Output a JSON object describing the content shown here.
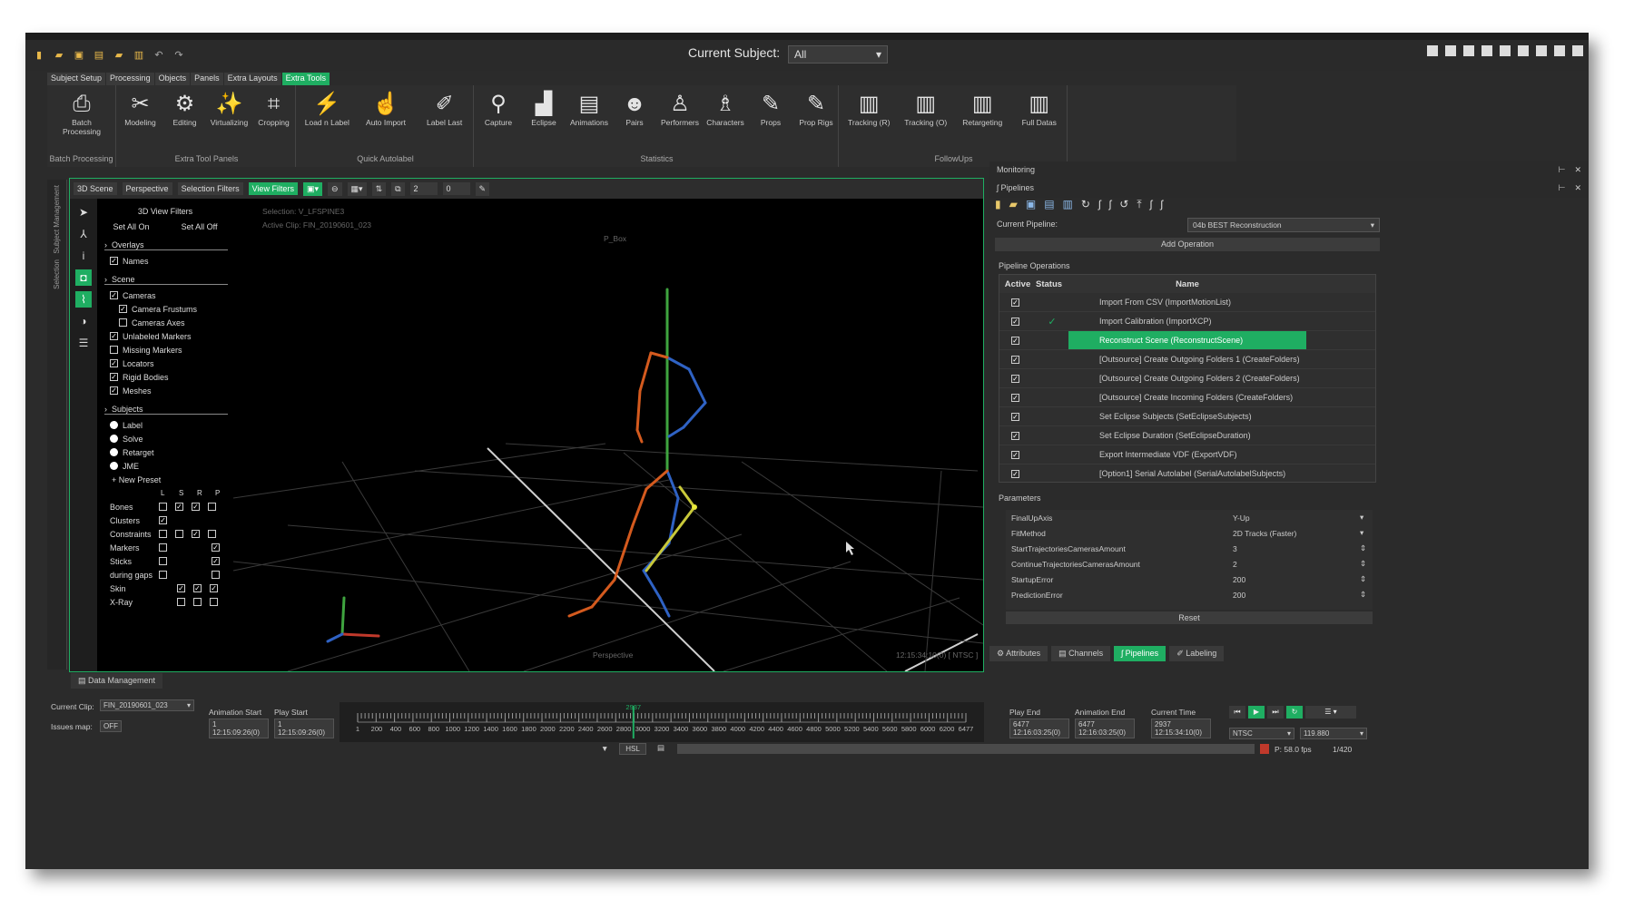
{
  "toolbar": {
    "current_subject_label": "Current Subject:",
    "current_subject_value": "All"
  },
  "tabs": [
    "Subject Setup",
    "Processing",
    "Objects",
    "Panels",
    "Extra Layouts",
    "Extra Tools"
  ],
  "active_tab": "Extra Tools",
  "ribbon": {
    "groups": [
      {
        "label": "Batch Processing",
        "buttons": [
          "Batch Processing"
        ]
      },
      {
        "label": "Extra Tool Panels",
        "buttons": [
          "Modeling",
          "Editing",
          "Virtualizing",
          "Cropping"
        ]
      },
      {
        "label": "Quick Autolabel",
        "buttons": [
          "Load n Label",
          "Auto Import",
          "Label Last"
        ]
      },
      {
        "label": "Statistics",
        "buttons": [
          "Capture",
          "Eclipse",
          "Animations",
          "Pairs",
          "Performers",
          "Characters",
          "Props",
          "Prop Rigs"
        ]
      },
      {
        "label": "FollowUps",
        "buttons": [
          "Tracking (R)",
          "Tracking (O)",
          "Retargeting",
          "Full Datas"
        ]
      }
    ]
  },
  "left_strip": {
    "tab1": "Subject Management",
    "tab2": "Selection"
  },
  "viewport": {
    "toolbar": [
      "3D Scene",
      "Perspective",
      "Selection Filters",
      "View Filters",
      "2",
      "0"
    ],
    "selection": "Selection: V_LFSPINE3",
    "active_clip": "Active Clip: FIN_20190601_023",
    "object_label": "P_Box",
    "camera_label": "Perspective",
    "timecode": "12:15:34:10(0) [ NTSC ]",
    "filters_title": "3D View Filters",
    "set_all_on": "Set All On",
    "set_all_off": "Set All Off",
    "overlays": "Overlays",
    "names": "Names",
    "scene": "Scene",
    "scene_items": [
      {
        "label": "Cameras",
        "checked": true,
        "indent": 0
      },
      {
        "label": "Camera Frustums",
        "checked": true,
        "indent": 1
      },
      {
        "label": "Cameras Axes",
        "checked": false,
        "indent": 1
      },
      {
        "label": "Unlabeled Markers",
        "checked": true,
        "indent": 0
      },
      {
        "label": "Missing Markers",
        "checked": false,
        "indent": 0
      },
      {
        "label": "Locators",
        "checked": true,
        "indent": 0
      },
      {
        "label": "Rigid Bodies",
        "checked": true,
        "indent": 0
      },
      {
        "label": "Meshes",
        "checked": true,
        "indent": 0
      }
    ],
    "subjects": "Subjects",
    "subject_presets": [
      "Label",
      "Solve",
      "Retarget",
      "JME"
    ],
    "new_preset": "+ New Preset",
    "grid_headers": [
      "L",
      "S",
      "R",
      "P"
    ],
    "grid_rows": [
      {
        "label": "Bones",
        "v": [
          0,
          1,
          1,
          0
        ]
      },
      {
        "label": "Clusters",
        "v": [
          1,
          -1,
          -1,
          -1
        ]
      },
      {
        "label": "Constraints",
        "v": [
          0,
          0,
          1,
          0
        ]
      },
      {
        "label": "Markers",
        "v": [
          0,
          -1,
          -1,
          1
        ]
      },
      {
        "label": "Sticks",
        "v": [
          0,
          -1,
          -1,
          1
        ]
      },
      {
        "label": "during gaps",
        "v": [
          0,
          -1,
          -1,
          0
        ]
      },
      {
        "label": "Skin",
        "v": [
          -1,
          1,
          1,
          1
        ]
      },
      {
        "label": "X-Ray",
        "v": [
          -1,
          0,
          0,
          0
        ]
      }
    ]
  },
  "monitoring": {
    "title": "Monitoring"
  },
  "pipelines": {
    "title": "Pipelines",
    "current_label": "Current Pipeline:",
    "current_value": "04b BEST Reconstruction",
    "add_operation": "Add Operation",
    "ops_label": "Pipeline Operations",
    "headers": {
      "active": "Active",
      "status": "Status",
      "name": "Name"
    },
    "operations": [
      {
        "name": "Import From CSV (ImportMotionList)",
        "status": ""
      },
      {
        "name": "Import Calibration (ImportXCP)",
        "status": "✓"
      },
      {
        "name": "Reconstruct Scene (ReconstructScene)",
        "status": ""
      },
      {
        "name": "[Outsource] Create Outgoing Folders 1 (CreateFolders)",
        "status": ""
      },
      {
        "name": "[Outsource] Create Outgoing Folders 2 (CreateFolders)",
        "status": ""
      },
      {
        "name": "[Outsource] Create Incoming Folders (CreateFolders)",
        "status": ""
      },
      {
        "name": "Set Eclipse Subjects (SetEclipseSubjects)",
        "status": ""
      },
      {
        "name": "Set Eclipse Duration (SetEclipseDuration)",
        "status": ""
      },
      {
        "name": "Export Intermediate VDF (ExportVDF)",
        "status": ""
      },
      {
        "name": "[Option1] Serial Autolabel (SerialAutolabelSubjects)",
        "status": ""
      }
    ],
    "params_label": "Parameters",
    "params": [
      {
        "key": "FinalUpAxis",
        "value": "Y-Up"
      },
      {
        "key": "FitMethod",
        "value": "2D Tracks (Faster)"
      },
      {
        "key": "StartTrajectoriesCamerasAmount",
        "value": "3"
      },
      {
        "key": "ContinueTrajectoriesCamerasAmount",
        "value": "2"
      },
      {
        "key": "StartupError",
        "value": "200"
      },
      {
        "key": "PredictionError",
        "value": "200"
      }
    ],
    "reset": "Reset"
  },
  "right_tabs": [
    "Attributes",
    "Channels",
    "Pipelines",
    "Labeling"
  ],
  "data_management": "Data Management",
  "timeline": {
    "current_clip_label": "Current Clip:",
    "current_clip": "FIN_20190601_023",
    "issues_label": "Issues map:",
    "issues_value": "OFF",
    "anim_start_label": "Animation Start",
    "anim_start": "1",
    "anim_start_tc": "12:15:09:26(0)",
    "play_start_label": "Play Start",
    "play_start": "1",
    "play_start_tc": "12:15:09:26(0)",
    "play_end_label": "Play End",
    "play_end": "6477",
    "play_end_tc": "12:16:03:25(0)",
    "anim_end_label": "Animation End",
    "anim_end": "6477",
    "anim_end_tc": "12:16:03:25(0)",
    "current_time_label": "Current Time",
    "current_time": "2937",
    "current_time_tc": "12:15:34:10(0)",
    "cursor_label": "2937",
    "ticks": [
      "1",
      "200",
      "400",
      "600",
      "800",
      "1000",
      "1200",
      "1400",
      "1600",
      "1800",
      "2000",
      "2200",
      "2400",
      "2600",
      "2800",
      "3000",
      "3200",
      "3400",
      "3600",
      "3800",
      "4000",
      "4200",
      "4400",
      "4600",
      "4800",
      "5000",
      "5200",
      "5400",
      "5600",
      "5800",
      "6000",
      "6200",
      "6477"
    ],
    "playhead_fraction": 0.4534,
    "standard": "NTSC",
    "fps_value": "119.880",
    "mode": "HSL",
    "fps_readout": "P: 58.0 fps",
    "counter": "1/420"
  }
}
